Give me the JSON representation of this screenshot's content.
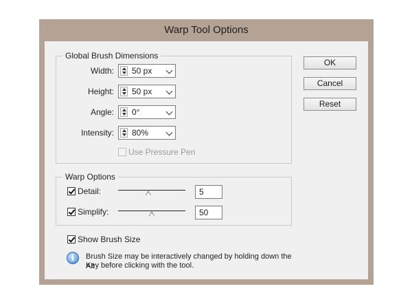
{
  "dialog": {
    "title": "Warp Tool Options"
  },
  "global_brush": {
    "title": "Global Brush Dimensions",
    "width": {
      "label": "Width:",
      "value": "50 px"
    },
    "height": {
      "label": "Height:",
      "value": "50 px"
    },
    "angle": {
      "label": "Angle:",
      "value": "0°"
    },
    "intensity": {
      "label": "Intensity:",
      "value": "80%"
    },
    "pressure_pen": {
      "label": "Use Pressure Pen",
      "checked": false,
      "disabled": true
    }
  },
  "warp_options": {
    "title": "Warp Options",
    "detail": {
      "label": "Detail:",
      "checked": true,
      "value": "5",
      "slider_fraction": 0.45
    },
    "simplify": {
      "label": "Simplify:",
      "checked": true,
      "value": "50",
      "slider_fraction": 0.5
    }
  },
  "show_brush_size": {
    "label": "Show Brush Size",
    "checked": true
  },
  "info": {
    "icon": "info-icon",
    "line1": "Brush Size may be interactively changed by holding down the Alt",
    "line2": "Key before clicking with the tool."
  },
  "buttons": {
    "ok": "OK",
    "cancel": "Cancel",
    "reset": "Reset"
  }
}
